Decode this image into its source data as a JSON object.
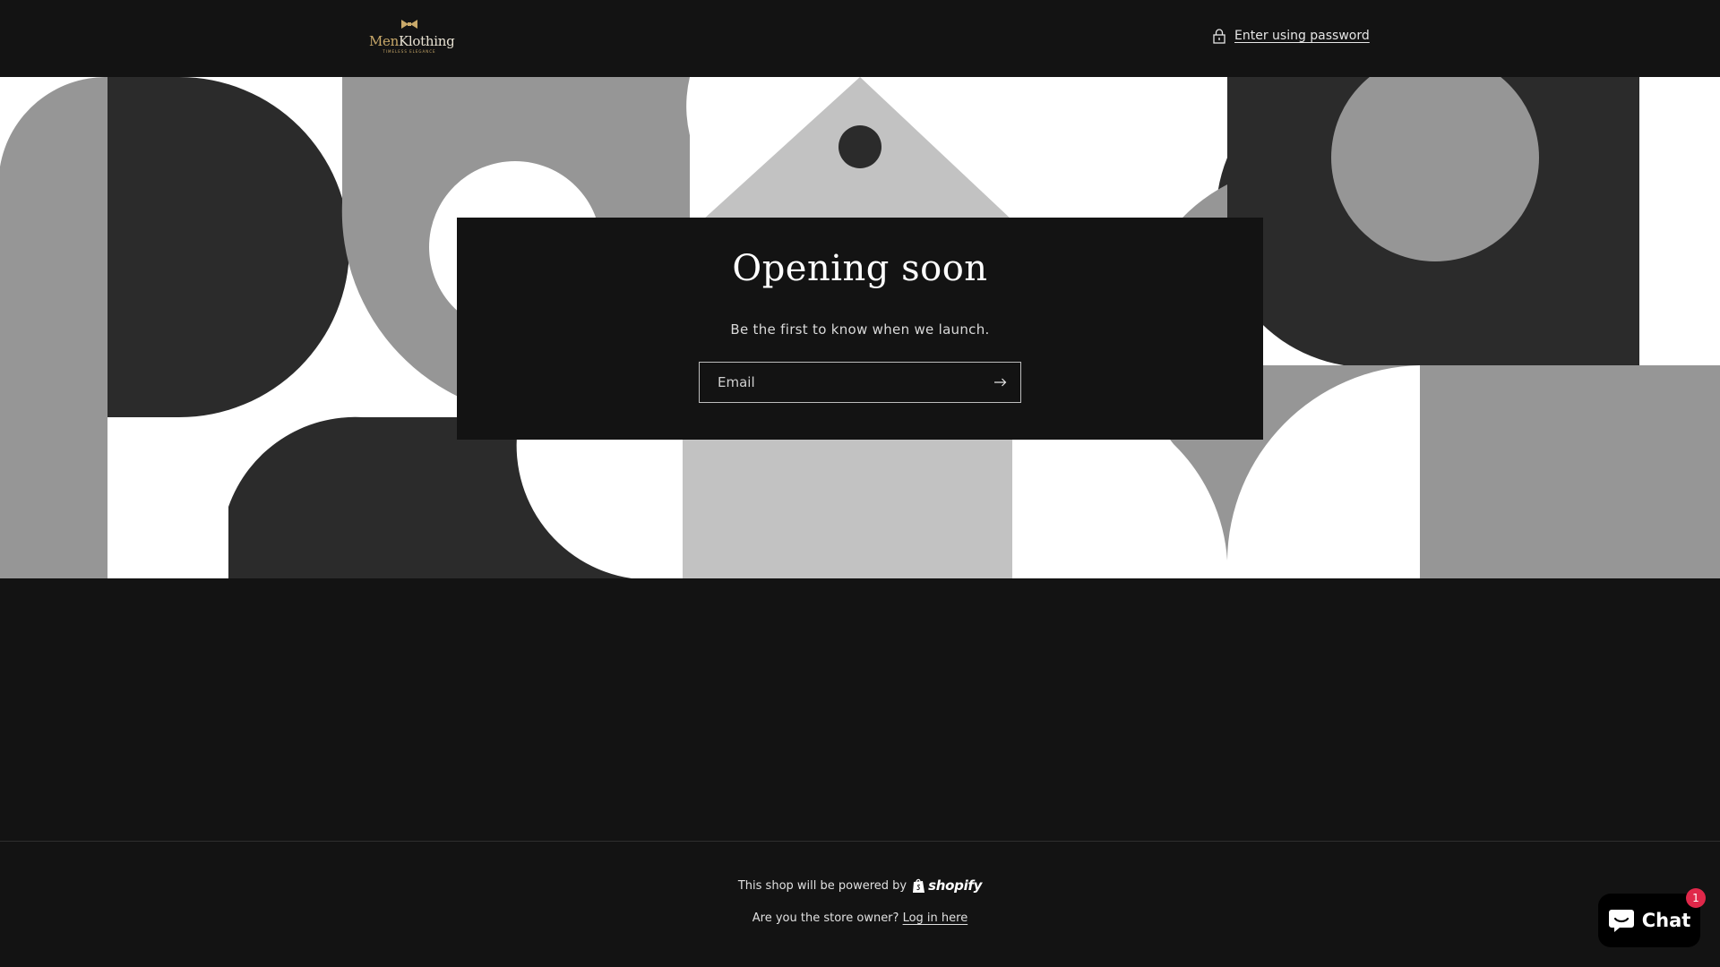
{
  "header": {
    "logo": {
      "brand_part1": "Men",
      "brand_part2": "Klothing",
      "tagline": "TIMELESS ELEGANCE"
    },
    "password_link": {
      "label": "Enter using password",
      "icon": "lock-icon"
    }
  },
  "hero": {
    "title": "Opening soon",
    "subtitle": "Be the first to know when we launch.",
    "email_placeholder": "Email",
    "submit_icon": "arrow-right-icon"
  },
  "footer": {
    "powered_text": "This shop will be powered by",
    "powered_brand": "shopify",
    "owner_question": "Are you the store owner?",
    "login_link": "Log in here"
  },
  "chat_widget": {
    "label": "Chat",
    "badge_count": "1",
    "icon": "chat-bubble-icon"
  },
  "colors": {
    "background": "#131313",
    "logo_gold": "#c9a96a",
    "dark_shape": "#2b2b2b",
    "mid_gray": "#969696",
    "light_gray": "#c2c2c2",
    "badge": "#e0284a"
  }
}
